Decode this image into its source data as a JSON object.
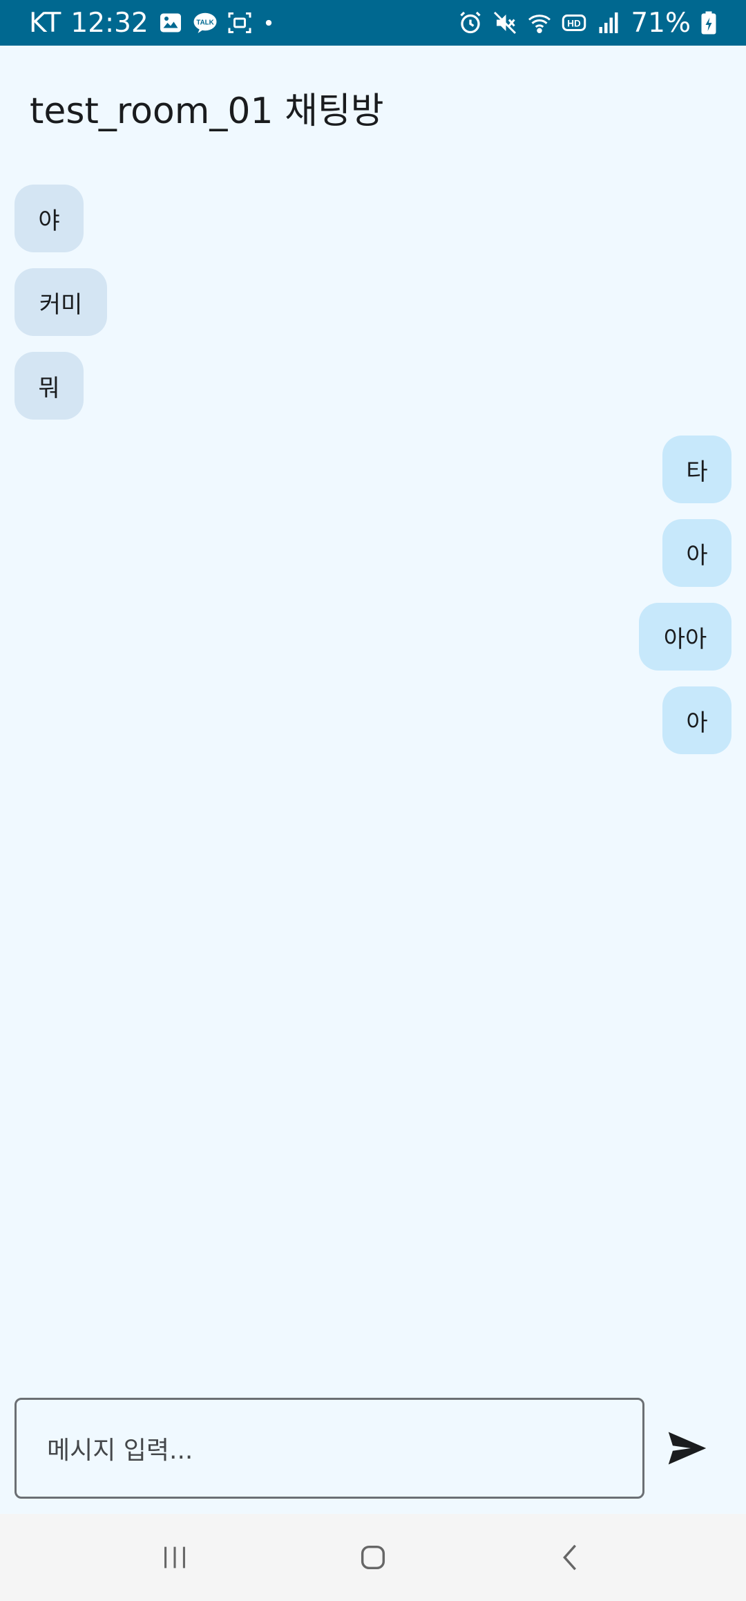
{
  "status_bar": {
    "carrier": "KT",
    "time": "12:32",
    "battery": "71%",
    "icons_left": [
      "gallery-icon",
      "talk-icon",
      "screenshot-icon",
      "dot-icon"
    ],
    "icons_right": [
      "alarm-icon",
      "mute-icon",
      "wifi-icon",
      "hd-icon",
      "signal-icon",
      "battery-charging-icon"
    ],
    "talk_badge": "TALK",
    "hd_badge": "HD"
  },
  "header": {
    "title": "test_room_01 채팅방"
  },
  "messages": [
    {
      "text": "야",
      "direction": "received"
    },
    {
      "text": "커미",
      "direction": "received"
    },
    {
      "text": "뭐",
      "direction": "received"
    },
    {
      "text": "타",
      "direction": "sent"
    },
    {
      "text": "아",
      "direction": "sent"
    },
    {
      "text": "아아",
      "direction": "sent"
    },
    {
      "text": "아",
      "direction": "sent"
    }
  ],
  "composer": {
    "placeholder": "메시지 입력..."
  },
  "colors": {
    "status_bar": "#006890",
    "background": "#f0f9ff",
    "received_bubble": "#d4e5f3",
    "sent_bubble": "#c7e8fb"
  }
}
